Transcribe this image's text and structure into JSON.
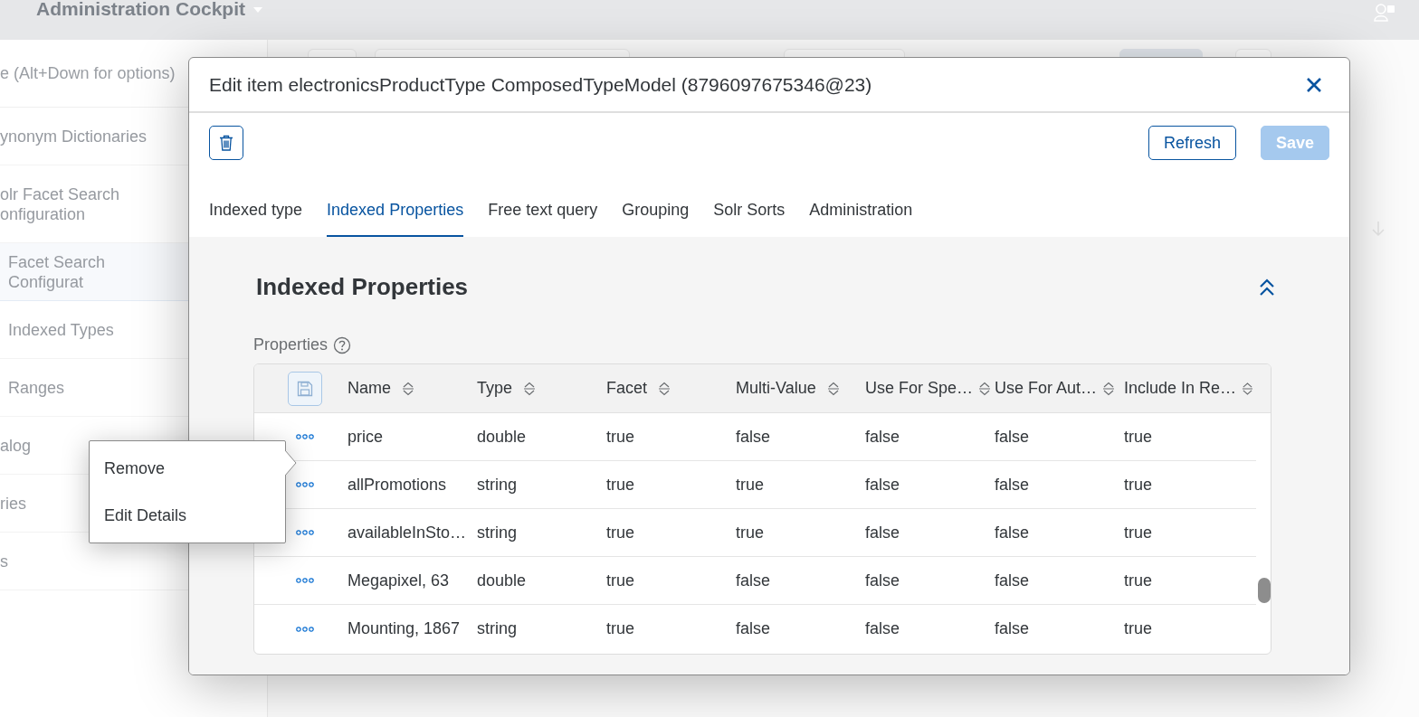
{
  "header": {
    "title": "Administration Cockpit"
  },
  "sidebar": {
    "search": {
      "placeholder": "e (Alt+Down for options)"
    },
    "items": [
      {
        "label": "ynonym Dictionaries",
        "selected": false
      },
      {
        "label": "olr Facet Search onfiguration",
        "selected": false,
        "children": [
          {
            "label": "Facet Search Configurat",
            "selected": true
          },
          {
            "label": "Indexed Types",
            "selected": false
          },
          {
            "label": "Ranges",
            "selected": false
          }
        ]
      },
      {
        "label": "alog",
        "selected": false
      },
      {
        "label": "ries",
        "selected": false
      },
      {
        "label": "s",
        "selected": false
      }
    ]
  },
  "dialog": {
    "title": "Edit item electronicsProductType ComposedTypeModel (8796097675346@23)",
    "buttons": [
      {
        "label": "Refresh",
        "kind": "secondary",
        "disabled": false
      },
      {
        "label": "Save",
        "kind": "primary",
        "disabled": true
      }
    ],
    "tabs": [
      {
        "label": "Indexed type",
        "selected": false
      },
      {
        "label": "Indexed Properties",
        "selected": true
      },
      {
        "label": "Free text query",
        "selected": false
      },
      {
        "label": "Grouping",
        "selected": false
      },
      {
        "label": "Solr Sorts",
        "selected": false
      },
      {
        "label": "Administration",
        "selected": false
      }
    ],
    "section": {
      "title": "Indexed Properties",
      "expanded": true
    },
    "table": {
      "label": "Properties",
      "columns": [
        "Name",
        "Type",
        "Facet",
        "Multi-Value",
        "Use For Spe…",
        "Use For Aut…",
        "Include In Re…"
      ],
      "rows": [
        {
          "cells": [
            "price",
            "double",
            "true",
            "false",
            "false",
            "false",
            "true"
          ]
        },
        {
          "cells": [
            "allPromotions",
            "string",
            "true",
            "true",
            "false",
            "false",
            "true"
          ]
        },
        {
          "cells": [
            "availableInSto…",
            "string",
            "true",
            "true",
            "false",
            "false",
            "true"
          ]
        },
        {
          "cells": [
            "Megapixel, 63",
            "double",
            "true",
            "false",
            "false",
            "false",
            "true"
          ]
        },
        {
          "cells": [
            "Mounting, 1867",
            "string",
            "true",
            "false",
            "false",
            "false",
            "true"
          ]
        }
      ]
    }
  },
  "context_menu": {
    "items": [
      "Remove",
      "Edit Details"
    ]
  }
}
